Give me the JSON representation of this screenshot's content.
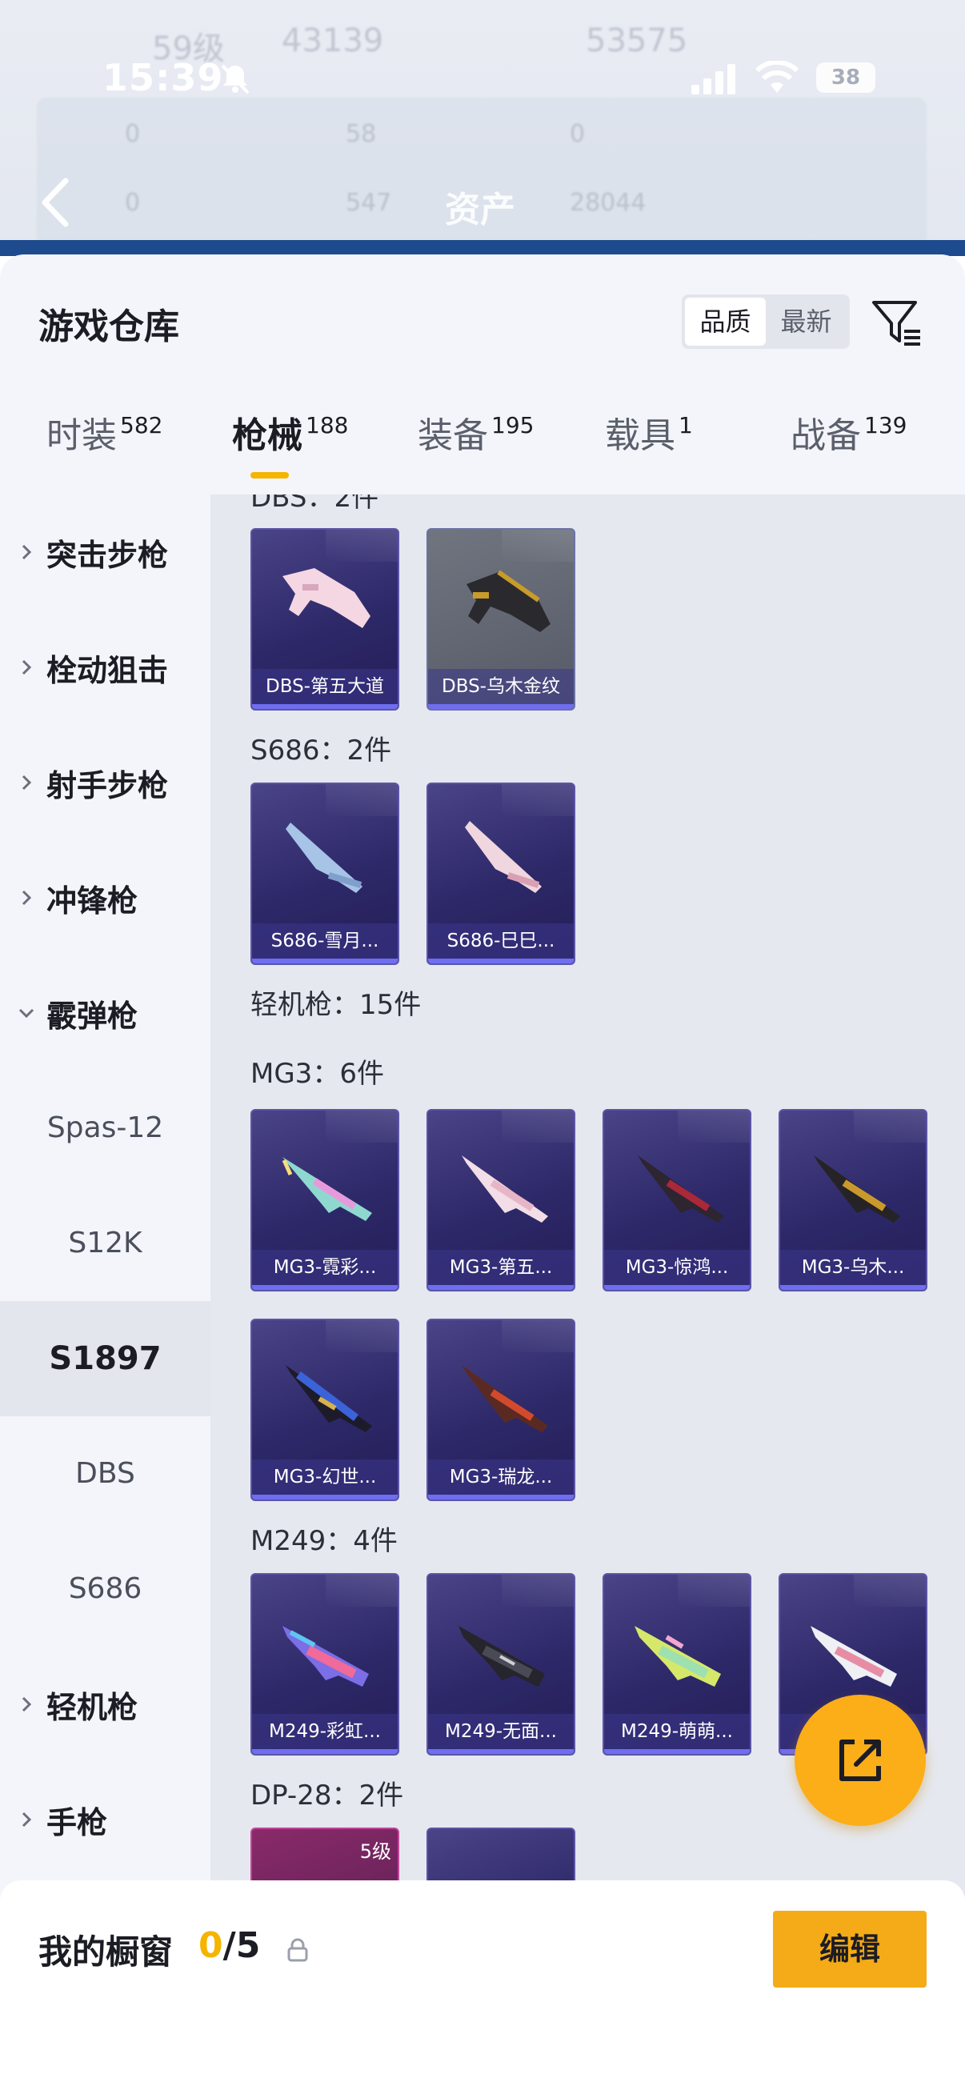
{
  "status_bar": {
    "time": "15:39",
    "battery": "38"
  },
  "backdrop": {
    "title": "资产",
    "ghost_texts": [
      "59级",
      "43139",
      "53575",
      "0",
      "58",
      "0",
      "0",
      "547",
      "28044"
    ]
  },
  "header": {
    "title": "游戏仓库",
    "sort_options": [
      "品质",
      "最新"
    ],
    "sort_active": "品质"
  },
  "tabs": [
    {
      "label": "时装",
      "count": "582"
    },
    {
      "label": "枪械",
      "count": "188"
    },
    {
      "label": "装备",
      "count": "195"
    },
    {
      "label": "载具",
      "count": "1"
    },
    {
      "label": "战备",
      "count": "139"
    }
  ],
  "active_tab": "枪械",
  "sidebar": {
    "categories": [
      {
        "label": "突击步枪"
      },
      {
        "label": "栓动狙击"
      },
      {
        "label": "射手步枪"
      },
      {
        "label": "冲锋枪"
      },
      {
        "label": "霰弹枪"
      }
    ],
    "subcategories": [
      "Spas-12",
      "S12K",
      "S1897",
      "DBS",
      "S686"
    ],
    "active_sub": "S1897",
    "categories_after": [
      {
        "label": "轻机枪"
      },
      {
        "label": "手枪"
      }
    ]
  },
  "content": {
    "groups": [
      {
        "label": "DBS：2件",
        "items": [
          "DBS-第五大道",
          "DBS-乌木金纹"
        ]
      },
      {
        "label": "S686：2件",
        "items": [
          "S686-雪月...",
          "S686-巳巳..."
        ]
      },
      {
        "label": "轻机枪：15件"
      },
      {
        "label": "MG3：6件",
        "items": [
          "MG3-霓彩...",
          "MG3-第五...",
          "MG3-惊鸿...",
          "MG3-乌木...",
          "MG3-幻世...",
          "MG3-瑞龙..."
        ]
      },
      {
        "label": "M249：4件",
        "items": [
          "M249-彩虹...",
          "M249-无面...",
          "M249-萌萌...",
          "M"
        ]
      },
      {
        "label": "DP-28：2件",
        "level_badge": "5级"
      }
    ]
  },
  "bottom_bar": {
    "label": "我的橱窗",
    "used": "0",
    "total": "/5",
    "edit_label": "编辑"
  },
  "colors": {
    "accent": "#f5b400",
    "fab": "#fbae17",
    "item_bg": "#2d2868"
  }
}
